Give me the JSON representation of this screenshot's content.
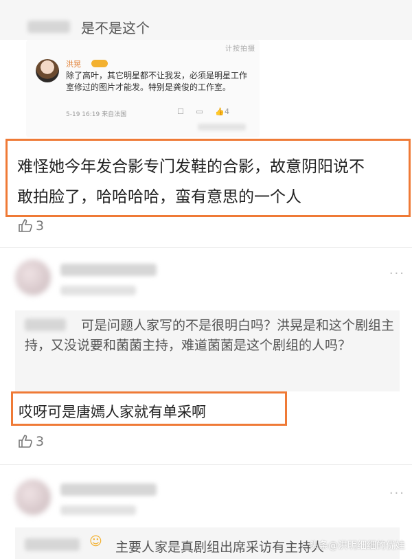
{
  "top_reply": {
    "text": "是不是这个"
  },
  "embedded_post": {
    "corner_text": "计按拍摄",
    "author": "洪晃",
    "body": "除了高叶，其它明星都不让我发，必须是明星工作室修过的图片才能发。特别是龚俊的工作室。",
    "meta": "5-19 16:19  来自法国",
    "actions": "☐  ▭  👍4",
    "like_count": "4"
  },
  "comment1": {
    "line1": "难怪她今年发合影专门发鞋的合影，故意阴阳说不",
    "line2": "敢拍脸了，哈哈哈哈，蛮有意思的一个人",
    "likes": "3"
  },
  "comment2": {
    "reply_text": "可是问题人家写的不是很明白吗？洪晃是和这个剧组主持，又没说要和菌菌主持，难道菌菌是这个剧组的人吗？",
    "highlight": "哎呀可是唐嫣人家就有单采啊",
    "likes": "3"
  },
  "comment3": {
    "reply_emoji": "☺",
    "reply_text": "主要人家是真剧组出席采访有主持人"
  },
  "more_icon": "···",
  "watermark": "头条@洪明细细的优娃"
}
